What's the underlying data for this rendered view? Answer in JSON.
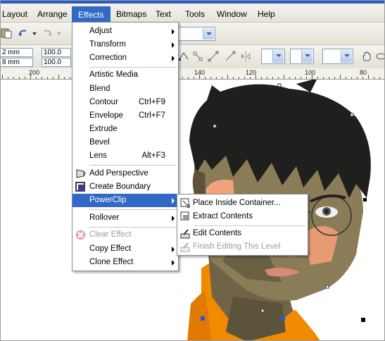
{
  "menubar": {
    "items": [
      "Layout",
      "Arrange",
      "Effects",
      "Bitmaps",
      "Text",
      "Tools",
      "Window",
      "Help"
    ],
    "active": "Effects"
  },
  "propbar": {
    "size_w": "2 mm",
    "size_h": "8 mm",
    "scale_x": "100.0",
    "scale_y": "100.0"
  },
  "ruler": {
    "labels": [
      "200",
      "140",
      "120",
      "100",
      "80"
    ]
  },
  "effects_menu": {
    "items": [
      {
        "label": "Adjust",
        "submenu": true
      },
      {
        "label": "Transform",
        "submenu": true
      },
      {
        "label": "Correction",
        "submenu": true
      },
      {
        "label": "Artistic Media"
      },
      {
        "label": "Blend"
      },
      {
        "label": "Contour",
        "shortcut": "Ctrl+F9"
      },
      {
        "label": "Envelope",
        "shortcut": "Ctrl+F7"
      },
      {
        "label": "Extrude"
      },
      {
        "label": "Bevel"
      },
      {
        "label": "Lens",
        "shortcut": "Alt+F3"
      },
      {
        "label": "Add Perspective",
        "icon": "perspective-icon"
      },
      {
        "label": "Create Boundary",
        "icon": "boundary-icon"
      },
      {
        "label": "PowerClip",
        "submenu": true,
        "highlighted": true
      },
      {
        "label": "Rollover",
        "submenu": true
      },
      {
        "label": "Clear Effect",
        "disabled": true,
        "icon": "clear-effect-icon"
      },
      {
        "label": "Copy Effect",
        "submenu": true
      },
      {
        "label": "Clone Effect",
        "submenu": true
      }
    ]
  },
  "powerclip_submenu": {
    "items": [
      {
        "label": "Place Inside Container...",
        "icon": "place-inside-icon"
      },
      {
        "label": "Extract Contents",
        "icon": "extract-contents-icon"
      },
      {
        "label": "Edit Contents",
        "icon": "edit-contents-icon"
      },
      {
        "label": "Finish Editing This Level",
        "disabled": true,
        "icon": "finish-editing-icon"
      }
    ]
  },
  "colors": {
    "accent": "#316ac5",
    "hair": "#1f1f1d",
    "skin_shadow": "#6a6043",
    "skin_mid": "#8a7c57",
    "skin_light": "#f0a37d",
    "shirt": "#f08a00"
  }
}
